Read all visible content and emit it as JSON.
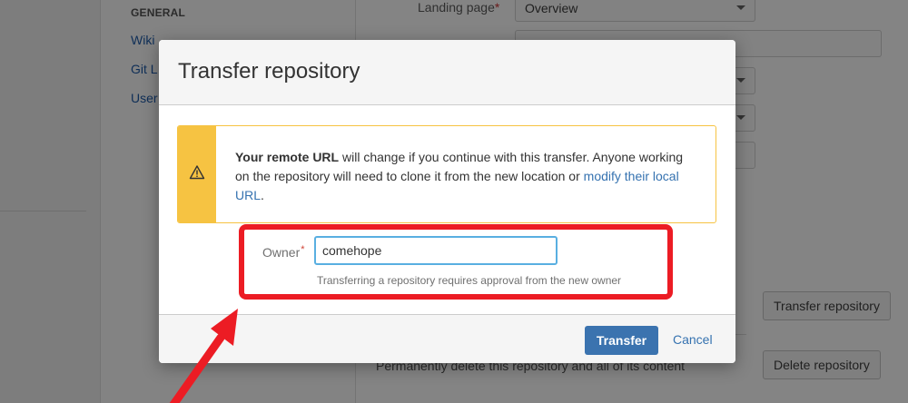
{
  "background": {
    "nav": {
      "heading": "GENERAL",
      "items": [
        "Wiki",
        "Git L",
        "User"
      ]
    },
    "form": {
      "landing_page_label": "Landing page",
      "landing_page_value": "Overview"
    },
    "transfer_button": "Transfer repository",
    "delete_text": "Permanently delete this repository and all of its content",
    "delete_button": "Delete repository"
  },
  "modal": {
    "title": "Transfer repository",
    "warning": {
      "icon": "warning-icon",
      "bold": "Your remote URL",
      "text": " will change if you continue with this transfer. Anyone working on the repository will need to clone it from the new location or ",
      "link": "modify their local URL",
      "end": "."
    },
    "owner": {
      "label": "Owner",
      "required_mark": "*",
      "value": "comehope",
      "help": "Transferring a repository requires approval from the new owner"
    },
    "footer": {
      "transfer_label": "Transfer",
      "cancel_label": "Cancel"
    }
  },
  "colors": {
    "primary": "#3b73af",
    "link": "#3572b0",
    "warning": "#f6c342",
    "annotation": "#ec1c24"
  }
}
